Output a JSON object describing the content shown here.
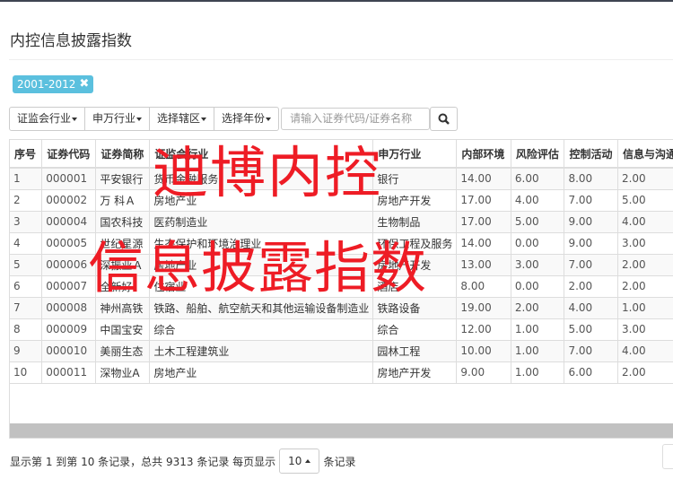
{
  "page": {
    "title": "内控信息披露指数"
  },
  "filter_badge": {
    "label": "2001-2012",
    "remove_icon": "close-icon"
  },
  "toolbar": {
    "dropdowns": [
      "证监会行业",
      "申万行业",
      "选择辖区",
      "选择年份"
    ],
    "search_placeholder": "请输入证券代码/证券名称",
    "search_icon": "search-icon"
  },
  "table": {
    "columns": [
      "序号",
      "证券代码",
      "证券简称",
      "证监会行业",
      "申万行业",
      "内部环境",
      "风险评估",
      "控制活动",
      "信息与沟通"
    ],
    "rows": [
      [
        "1",
        "000001",
        "平安银行",
        "货币金融服务",
        "银行",
        "14.00",
        "6.00",
        "8.00",
        "2.00"
      ],
      [
        "2",
        "000002",
        "万 科Ａ",
        "房地产业",
        "房地产开发",
        "17.00",
        "4.00",
        "7.00",
        "5.00"
      ],
      [
        "3",
        "000004",
        "国农科技",
        "医药制造业",
        "生物制品",
        "17.00",
        "5.00",
        "9.00",
        "4.00"
      ],
      [
        "4",
        "000005",
        "世纪星源",
        "生态保护和环境治理业",
        "环保工程及服务",
        "14.00",
        "0.00",
        "9.00",
        "3.00"
      ],
      [
        "5",
        "000006",
        "深振业Ａ",
        "房地产业",
        "房地产开发",
        "13.00",
        "3.00",
        "7.00",
        "2.00"
      ],
      [
        "6",
        "000007",
        "全新好",
        "住宿业",
        "酒店",
        "8.00",
        "0.00",
        "2.00",
        "2.00"
      ],
      [
        "7",
        "000008",
        "神州高铁",
        "铁路、船舶、航空航天和其他运输设备制造业",
        "铁路设备",
        "19.00",
        "2.00",
        "4.00",
        "1.00"
      ],
      [
        "8",
        "000009",
        "中国宝安",
        "综合",
        "综合",
        "12.00",
        "1.00",
        "5.00",
        "3.00"
      ],
      [
        "9",
        "000010",
        "美丽生态",
        "土木工程建筑业",
        "园林工程",
        "10.00",
        "1.00",
        "7.00",
        "4.00"
      ],
      [
        "10",
        "000011",
        "深物业A",
        "房地产业",
        "房地产开发",
        "9.00",
        "1.00",
        "6.00",
        "2.00"
      ]
    ]
  },
  "footer": {
    "summary": "显示第 1 到第 10 条记录，总共 9313 条记录 每页显示",
    "page_size": "10",
    "suffix": "条记录"
  },
  "watermark": {
    "line1": "迪博内控",
    "line2": "信息披露指数"
  },
  "colors": {
    "badge": "#5bc0de",
    "watermark": "#ee1c25",
    "topbar": "#3f4552"
  }
}
